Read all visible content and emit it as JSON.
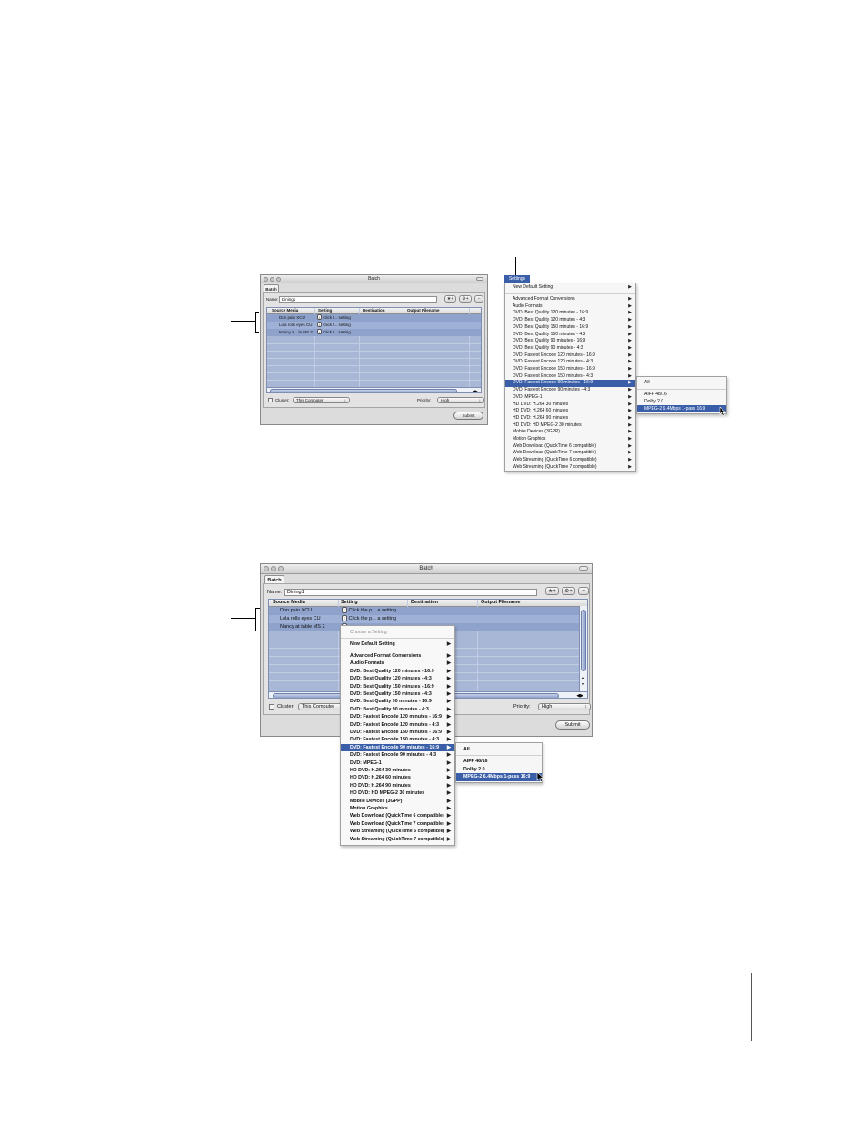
{
  "top": {
    "window_title": "Batch",
    "tab": "Batch",
    "name_label": "Name:",
    "name_value": "Dining1",
    "columns": [
      "Source Media",
      "Setting",
      "Destination",
      "Output Filename"
    ],
    "rows": [
      {
        "source": "Don pain XCU",
        "setting": "Click t... setting"
      },
      {
        "source": "Lola rolls eyes CU",
        "setting": "Click t... setting"
      },
      {
        "source": "Nancy a... le MS 2",
        "setting": "Click t... setting"
      }
    ],
    "cluster_label": "Cluster:",
    "cluster_value": "This Computer",
    "priority_label": "Priority:",
    "priority_value": "High",
    "submit": "Submit",
    "settings_menu_title": "Settings",
    "menu_items": [
      "New Default Setting",
      "Advanced Format Conversions",
      "Audio Formats",
      "DVD: Best Quality 120 minutes - 16:9",
      "DVD: Best Quality 120 minutes - 4:3",
      "DVD: Best Quality 150 minutes - 16:9",
      "DVD: Best Quality 150 minutes - 4:3",
      "DVD: Best Quality 90 minutes - 16:9",
      "DVD: Best Quality 90 minutes - 4:3",
      "DVD: Fastest Encode 120 minutes - 16:9",
      "DVD: Fastest Encode 120 minutes - 4:3",
      "DVD: Fastest Encode 150 minutes - 16:9",
      "DVD: Fastest Encode 150 minutes - 4:3",
      "DVD: Fastest Encode 90 minutes - 16:9",
      "DVD: Fastest Encode 90 minutes - 4:3",
      "DVD: MPEG-1",
      "HD DVD: H.264 30 minutes",
      "HD DVD: H.264 60 minutes",
      "HD DVD: H.264 90 minutes",
      "HD DVD: HD MPEG-2 30 minutes",
      "Mobile Devices (3GPP)",
      "Motion Graphics",
      "Web Download (QuickTime 6 compatible)",
      "Web Download (QuickTime 7 compatible)",
      "Web Streaming (QuickTime 6 compatible)",
      "Web Streaming (QuickTime 7 compatible)"
    ],
    "submenu_items": [
      "All",
      "AIFF 48/16",
      "Dolby 2.0",
      "MPEG-2 6.4Mbps 1-pass 16:9"
    ]
  },
  "bottom": {
    "window_title": "Batch",
    "tab": "Batch",
    "name_label": "Name:",
    "name_value": "Dining1",
    "columns": [
      "Source Media",
      "Setting",
      "Destination",
      "Output Filename"
    ],
    "rows": [
      {
        "source": "Don pain XCU",
        "setting": "Click the p... a setting"
      },
      {
        "source": "Lola rolls eyes CU",
        "setting": "Click the p... a setting"
      },
      {
        "source": "Nancy at table MS 2",
        "setting": ""
      }
    ],
    "cluster_label": "Cluster:",
    "cluster_value": "This Computer",
    "priority_label": "Priority:",
    "priority_value": "High",
    "submit": "Submit",
    "menu_header": "Choose a Setting",
    "menu_items": [
      "New Default Setting",
      "Advanced Format Conversions",
      "Audio Formats",
      "DVD: Best Quality 120 minutes - 16:9",
      "DVD: Best Quality 120 minutes - 4:3",
      "DVD: Best Quality 150 minutes - 16:9",
      "DVD: Best Quality 150 minutes - 4:3",
      "DVD: Best Quality 90 minutes - 16:9",
      "DVD: Best Quality 90 minutes - 4:3",
      "DVD: Fastest Encode 120 minutes - 16:9",
      "DVD: Fastest Encode 120 minutes - 4:3",
      "DVD: Fastest Encode 150 minutes - 16:9",
      "DVD: Fastest Encode 150 minutes - 4:3",
      "DVD: Fastest Encode 90 minutes - 16:9",
      "DVD: Fastest Encode 90 minutes - 4:3",
      "DVD: MPEG-1",
      "HD DVD: H.264 30 minutes",
      "HD DVD: H.264 60 minutes",
      "HD DVD: H.264 90 minutes",
      "HD DVD: HD MPEG-2 30 minutes",
      "Mobile Devices (3GPP)",
      "Motion Graphics",
      "Web Download (QuickTime 6 compatible)",
      "Web Download (QuickTime 7 compatible)",
      "Web Streaming (QuickTime 6 compatible)",
      "Web Streaming (QuickTime 7 compatible)"
    ],
    "submenu_items": [
      "All",
      "AIFF 48/16",
      "Dolby 2.0",
      "MPEG-2 6.4Mbps 1-pass 16:9"
    ]
  },
  "colors": {
    "highlight": "#3a5fa8",
    "selected_rows": "#8ea2cc",
    "table_bg": "#a8b7d6"
  }
}
